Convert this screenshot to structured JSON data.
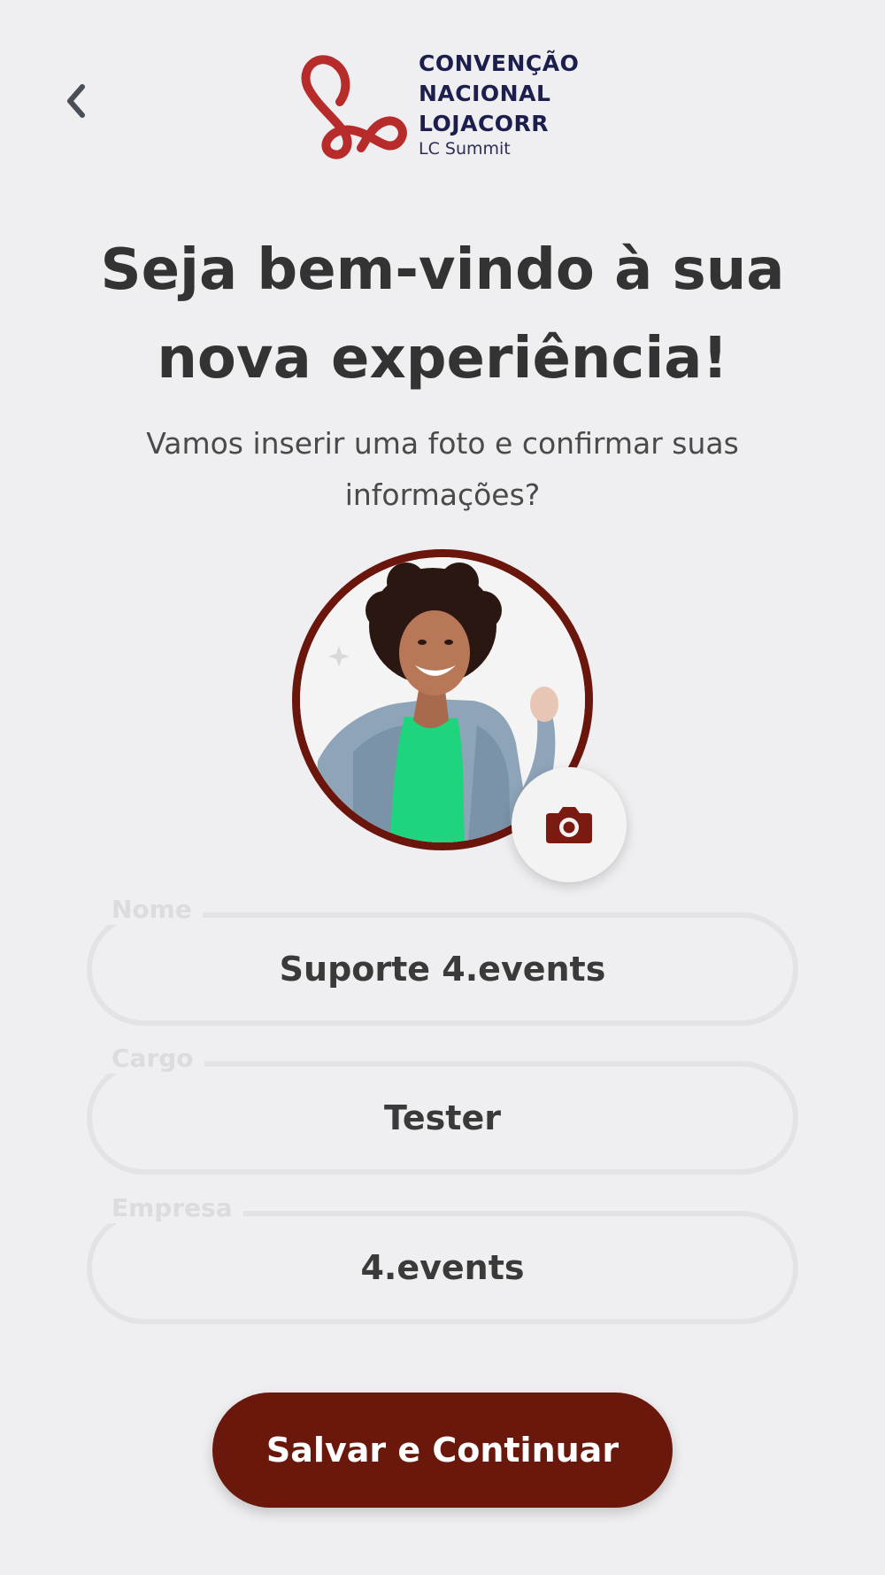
{
  "header": {
    "logo": {
      "lines": [
        "CONVENÇÃO",
        "NACIONAL",
        "LOJACORR"
      ],
      "subtitle": "LC Summit",
      "mark_color": "#b72b2b",
      "text_color": "#1c1f4d"
    },
    "back_icon": "chevron-left-icon"
  },
  "main": {
    "title_line1": "Seja bem-vindo à sua",
    "title_line2": "nova experiência!",
    "subtitle_line1": "Vamos inserir uma foto e confirmar suas",
    "subtitle_line2": "informações?"
  },
  "avatar": {
    "ring_color": "#6b160d",
    "camera_icon": "camera-icon"
  },
  "form": {
    "fields": [
      {
        "label": "Nome",
        "value": "Suporte 4.events"
      },
      {
        "label": "Cargo",
        "value": "Tester"
      },
      {
        "label": "Empresa",
        "value": "4.events"
      }
    ]
  },
  "actions": {
    "save_label": "Salvar e Continuar",
    "button_color": "#6b180c"
  }
}
